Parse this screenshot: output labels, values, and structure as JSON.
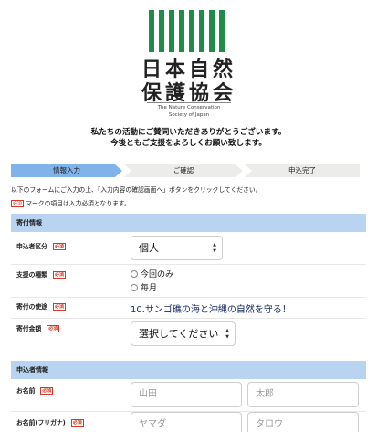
{
  "logo": {
    "name_line1": "日本自然",
    "name_line2": "保護協会",
    "en_line1": "The Nature Conservation",
    "en_line2": "Society of Japan",
    "color": "#1f8c4a"
  },
  "thanks": {
    "line1": "私たちの活動にご賛同いただきありがとうございます。",
    "line2": "今後ともご支援をよろしくお願い致します。"
  },
  "steps": [
    {
      "label": "情報入力",
      "active": true
    },
    {
      "label": "ご確認",
      "active": false
    },
    {
      "label": "申込完了",
      "active": false
    }
  ],
  "intro": {
    "line1": "以下のフォームにご入力の上、「入力内容の確認画面へ」ボタンをクリックしてください。",
    "line2": "マークの項目は入力必須となります。"
  },
  "required_mark": "必須",
  "donation": {
    "heading": "寄付情報",
    "applicant_type_label": "申込者区分",
    "applicant_type_value": "個人",
    "support_kind_label": "支援の種類",
    "support_options": [
      "今回のみ",
      "毎月"
    ],
    "purpose_label": "寄付の使途",
    "purpose_value": "10.サンゴ礁の海と沖縄の自然を守る！",
    "amount_label": "寄付金額",
    "amount_value": "選択してください"
  },
  "applicant": {
    "heading": "申込者情報",
    "name_label": "お名前",
    "last_name_placeholder": "山田",
    "first_name_placeholder": "太郎",
    "kana_label": "お名前(フリガナ)",
    "last_kana_placeholder": "ヤマダ",
    "first_kana_placeholder": "タロウ"
  },
  "colors": {
    "step_active": "#7fb3ea",
    "step_inactive": "#ececea",
    "section_head": "#b8d4f1",
    "required": "#d43a2c",
    "purpose_text": "#1a2a66"
  }
}
